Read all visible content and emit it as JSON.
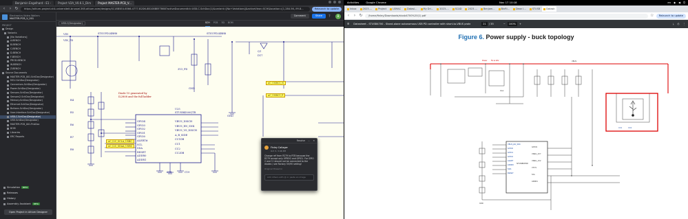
{
  "left": {
    "browser": {
      "tabs": [
        "Benjamin Engelhard - E1 -",
        "Project V2A_V0.6.1_Dim",
        "Project MASTER-PCB_V..."
      ],
      "url": "https://altium-project-vt4-universiteit-brussel.365.altium.com/designs/4118B5E4-6566-4777-B2D6-8B108BBF7868?activeDocumentId=USB-C.SchDoc(1)&variant=[No+Variations]&activeView=SCH&location=[1,284.56,-99.8...",
      "relaunch": "Relaunch to update"
    },
    "project": {
      "workspace": "Electronics Kalea Wallers",
      "name": "MASTER-PCB_V_001"
    },
    "sidebar": {
      "caption": "PROJECT",
      "tree": [
        {
          "label": "Design",
          "selected": false
        },
        {
          "label": "Variants",
          "selected": false
        },
        {
          "label": "[No Variations]",
          "selected": false
        },
        {
          "label": "A-BENCH",
          "selected": false
        },
        {
          "label": "B-BENCH",
          "selected": false
        },
        {
          "label": "C-BENCH",
          "selected": false
        },
        {
          "label": "D-BENCH",
          "selected": false
        },
        {
          "label": "F-BENCH",
          "selected": false
        },
        {
          "label": "PROD-BENCH",
          "selected": false
        },
        {
          "label": "W-BENCH",
          "selected": false
        },
        {
          "label": "Z-BENCH",
          "selected": false
        },
        {
          "label": "Source Documents",
          "selected": false
        },
        {
          "label": "MASTER-PCB_001.SchDoc(Designator)",
          "selected": false
        },
        {
          "label": "MCU.SchDoc(Designator)",
          "selected": false
        },
        {
          "label": "Connectors.SchDoc(Designator)",
          "selected": false
        },
        {
          "label": "Power.SchDoc(Designator)",
          "selected": false
        },
        {
          "label": "Sensors.SchDoc(Designator)",
          "selected": false
        },
        {
          "label": "Sensors2.SchDoc(Designator)",
          "selected": false
        },
        {
          "label": "Memory.SchDoc(Designator)",
          "selected": false
        },
        {
          "label": "Ethernet.SchDoc(Designator)",
          "selected": false
        },
        {
          "label": "Buttons.SchDoc(Designator)",
          "selected": false
        },
        {
          "label": "User-Interface.SchDoc(Designator)",
          "selected": false
        },
        {
          "label": "USB-C.SchDoc(Designator)",
          "selected": true
        },
        {
          "label": "USB.SchDoc(Designator)",
          "selected": false
        },
        {
          "label": "MASTER-PCB_001.PcbDoc",
          "selected": false
        },
        {
          "label": "BOM",
          "selected": false
        },
        {
          "label": "Libraries",
          "selected": false
        },
        {
          "label": "ERC Reports",
          "selected": false
        }
      ],
      "bottom": [
        {
          "label": "Simulation",
          "badge": "BETA"
        },
        {
          "label": "Releases",
          "badge": ""
        },
        {
          "label": "History",
          "badge": ""
        },
        {
          "label": "Assembly Assistant",
          "badge": "BETA"
        }
      ],
      "open_designer": "Open Project in Altium Designer"
    },
    "header": {
      "comment": "Comment",
      "share": "Share",
      "avatar": "B"
    },
    "doc": {
      "selected": "USB-C(Designator)",
      "views": [
        "SCH",
        "PCB",
        "3D",
        "BOM"
      ],
      "active_view": "SCH"
    },
    "schematic": {
      "part": "U25",
      "part_name": "STUSB4500QTR",
      "pins_left": [
        "GPIO4",
        "GPIO3",
        "GPIO2",
        "GPIO1",
        "GPIO0",
        "ALERT#",
        "SCL",
        "SDA",
        "RESET",
        "ADDR0",
        "ADDR1"
      ],
      "pins_right": [
        "VBUS_DISCH",
        "VBUS_EN_SNK",
        "VBUS_VS_DISCH",
        "A_B_SIDE",
        "CC1DB",
        "CC1",
        "CC2",
        "CC2DB"
      ],
      "net_flags": [
        "uC_USBC1_N",
        "uC_USBC1_P",
        "uC_I2C_SCLA_USBC",
        "uC_I2C_SDAA_USBC"
      ],
      "notes": [
        "Diode 15 generated by",
        "IL2808 and the full ladder"
      ],
      "labels": [
        "VIN",
        "VIN_PD",
        "GND",
        "3V3_PD",
        "SUPPLY",
        "VBUS",
        "GND",
        "R4",
        "R5",
        "R6",
        "R7",
        "R8",
        "R9",
        "C18",
        "C19",
        "Q1",
        "D17",
        "SMBJ24CA-TR",
        "STSUPD24BH8"
      ]
    },
    "comment": {
      "resolve": "Resolve",
      "user": "Finley Callager",
      "time": "Oct 3, 3:46 PM",
      "message": "Change ref from R279 to R78 because the R279 accept only VPROG and GPIO1. For GPIO 2 and 3 I should not be connected to the diodes / see Factory 5V/9V setting!",
      "hint": "Original thread in",
      "placeholder": "Add others with @ or paste an image"
    }
  },
  "right": {
    "gnome": {
      "activities": "Activities",
      "app": "Google Chrome",
      "clock": "Nov 17  10:18",
      "lang": "en"
    },
    "browser": {
      "tabs": [
        "Inbox",
        "2023-...",
        "Project",
        "LSMAC",
        "Datasl...",
        "My Dri...",
        "2023-...",
        "SCAD",
        "2023-...",
        "Benjam...",
        "BinRi...",
        "Dean I...",
        "STUSB",
        "Datash"
      ],
      "url": "/home/finley/Downloads/stusb4700%20(1).pdf",
      "relaunch": "Relaunch to update"
    },
    "pdf": {
      "title": "Datasheet - STUSB4700 - Stand-alone autonomous USB PD controller with short-to-VBUS protections",
      "page": "21",
      "pages": "/ 35",
      "zoom": "100%",
      "figure_num": "Figure 6.",
      "figure_text": "Power supply - buck topology",
      "chip": "STUSB4700",
      "labels": [
        "Power",
        "5V to 20V",
        "VBUS",
        "Vout",
        "GND",
        "CC1",
        "CC2",
        "VBUS_EN_SNK",
        "GPIO0",
        "GPIO1",
        "GPIO2",
        "GPIO3",
        "VREG_2V7",
        "VREG_1V2",
        "VSYS",
        "SCL",
        "SDA",
        "ALERT",
        "ADDR0",
        "ADDR1",
        "RESET"
      ]
    }
  }
}
